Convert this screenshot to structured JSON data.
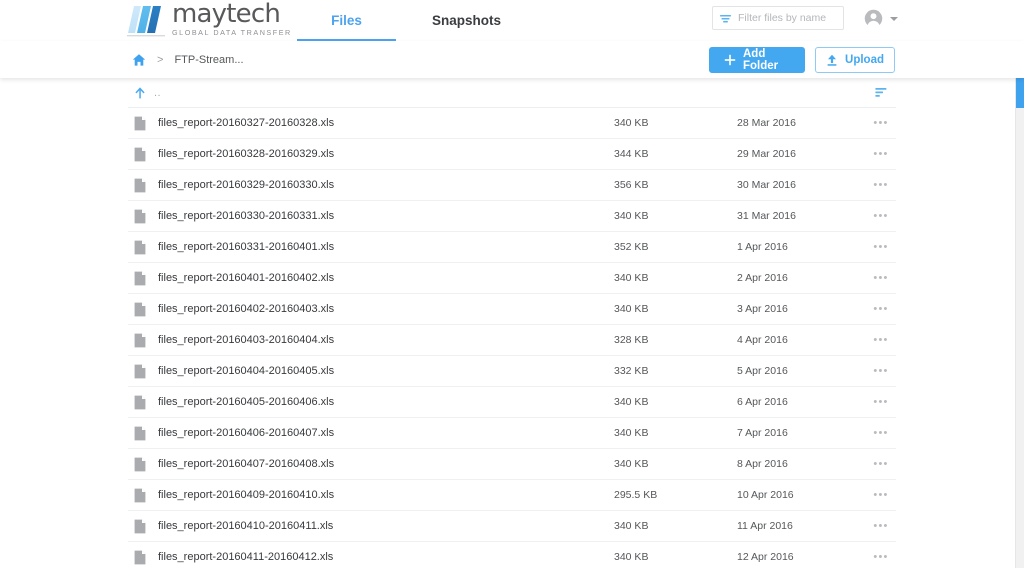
{
  "brand": {
    "name": "maytech",
    "tagline": "GLOBAL DATA TRANSFER",
    "accent_color": "#43a8f0",
    "logo_icon": "maytech-parallelogram-logo"
  },
  "nav": {
    "tabs": [
      {
        "label": "Files",
        "active": true
      },
      {
        "label": "Snapshots",
        "active": false
      }
    ]
  },
  "search": {
    "placeholder": "Filter files by name",
    "value": "",
    "icon": "filter-icon"
  },
  "account": {
    "avatar_icon": "account-circle-icon",
    "caret_icon": "chevron-down-icon"
  },
  "breadcrumb": {
    "home_icon": "home-icon",
    "separator": ">",
    "current": "FTP-Stream..."
  },
  "toolbar": {
    "add_folder_label": "Add Folder",
    "add_folder_icon": "plus-icon",
    "upload_label": "Upload",
    "upload_icon": "upload-arrow-icon"
  },
  "filelist": {
    "parent_row": {
      "up_icon": "arrow-up-icon",
      "label": ".."
    },
    "sort_icon": "sort-descending-icon",
    "row_menu_icon": "overflow-menu-icon",
    "file_icon": "document-file-icon",
    "rows": [
      {
        "name": "files_report-20160327-20160328.xls",
        "size": "340 KB",
        "date": "28 Mar 2016"
      },
      {
        "name": "files_report-20160328-20160329.xls",
        "size": "344 KB",
        "date": "29 Mar 2016"
      },
      {
        "name": "files_report-20160329-20160330.xls",
        "size": "356 KB",
        "date": "30 Mar 2016"
      },
      {
        "name": "files_report-20160330-20160331.xls",
        "size": "340 KB",
        "date": "31 Mar 2016"
      },
      {
        "name": "files_report-20160331-20160401.xls",
        "size": "352 KB",
        "date": "1 Apr 2016"
      },
      {
        "name": "files_report-20160401-20160402.xls",
        "size": "340 KB",
        "date": "2 Apr 2016"
      },
      {
        "name": "files_report-20160402-20160403.xls",
        "size": "340 KB",
        "date": "3 Apr 2016"
      },
      {
        "name": "files_report-20160403-20160404.xls",
        "size": "328 KB",
        "date": "4 Apr 2016"
      },
      {
        "name": "files_report-20160404-20160405.xls",
        "size": "332 KB",
        "date": "5 Apr 2016"
      },
      {
        "name": "files_report-20160405-20160406.xls",
        "size": "340 KB",
        "date": "6 Apr 2016"
      },
      {
        "name": "files_report-20160406-20160407.xls",
        "size": "340 KB",
        "date": "7 Apr 2016"
      },
      {
        "name": "files_report-20160407-20160408.xls",
        "size": "340 KB",
        "date": "8 Apr 2016"
      },
      {
        "name": "files_report-20160409-20160410.xls",
        "size": "295.5 KB",
        "date": "10 Apr 2016"
      },
      {
        "name": "files_report-20160410-20160411.xls",
        "size": "340 KB",
        "date": "11 Apr 2016"
      },
      {
        "name": "files_report-20160411-20160412.xls",
        "size": "340 KB",
        "date": "12 Apr 2016"
      }
    ]
  },
  "scrollbar": {
    "thumb_color": "#3fa2ef",
    "position": "top"
  }
}
